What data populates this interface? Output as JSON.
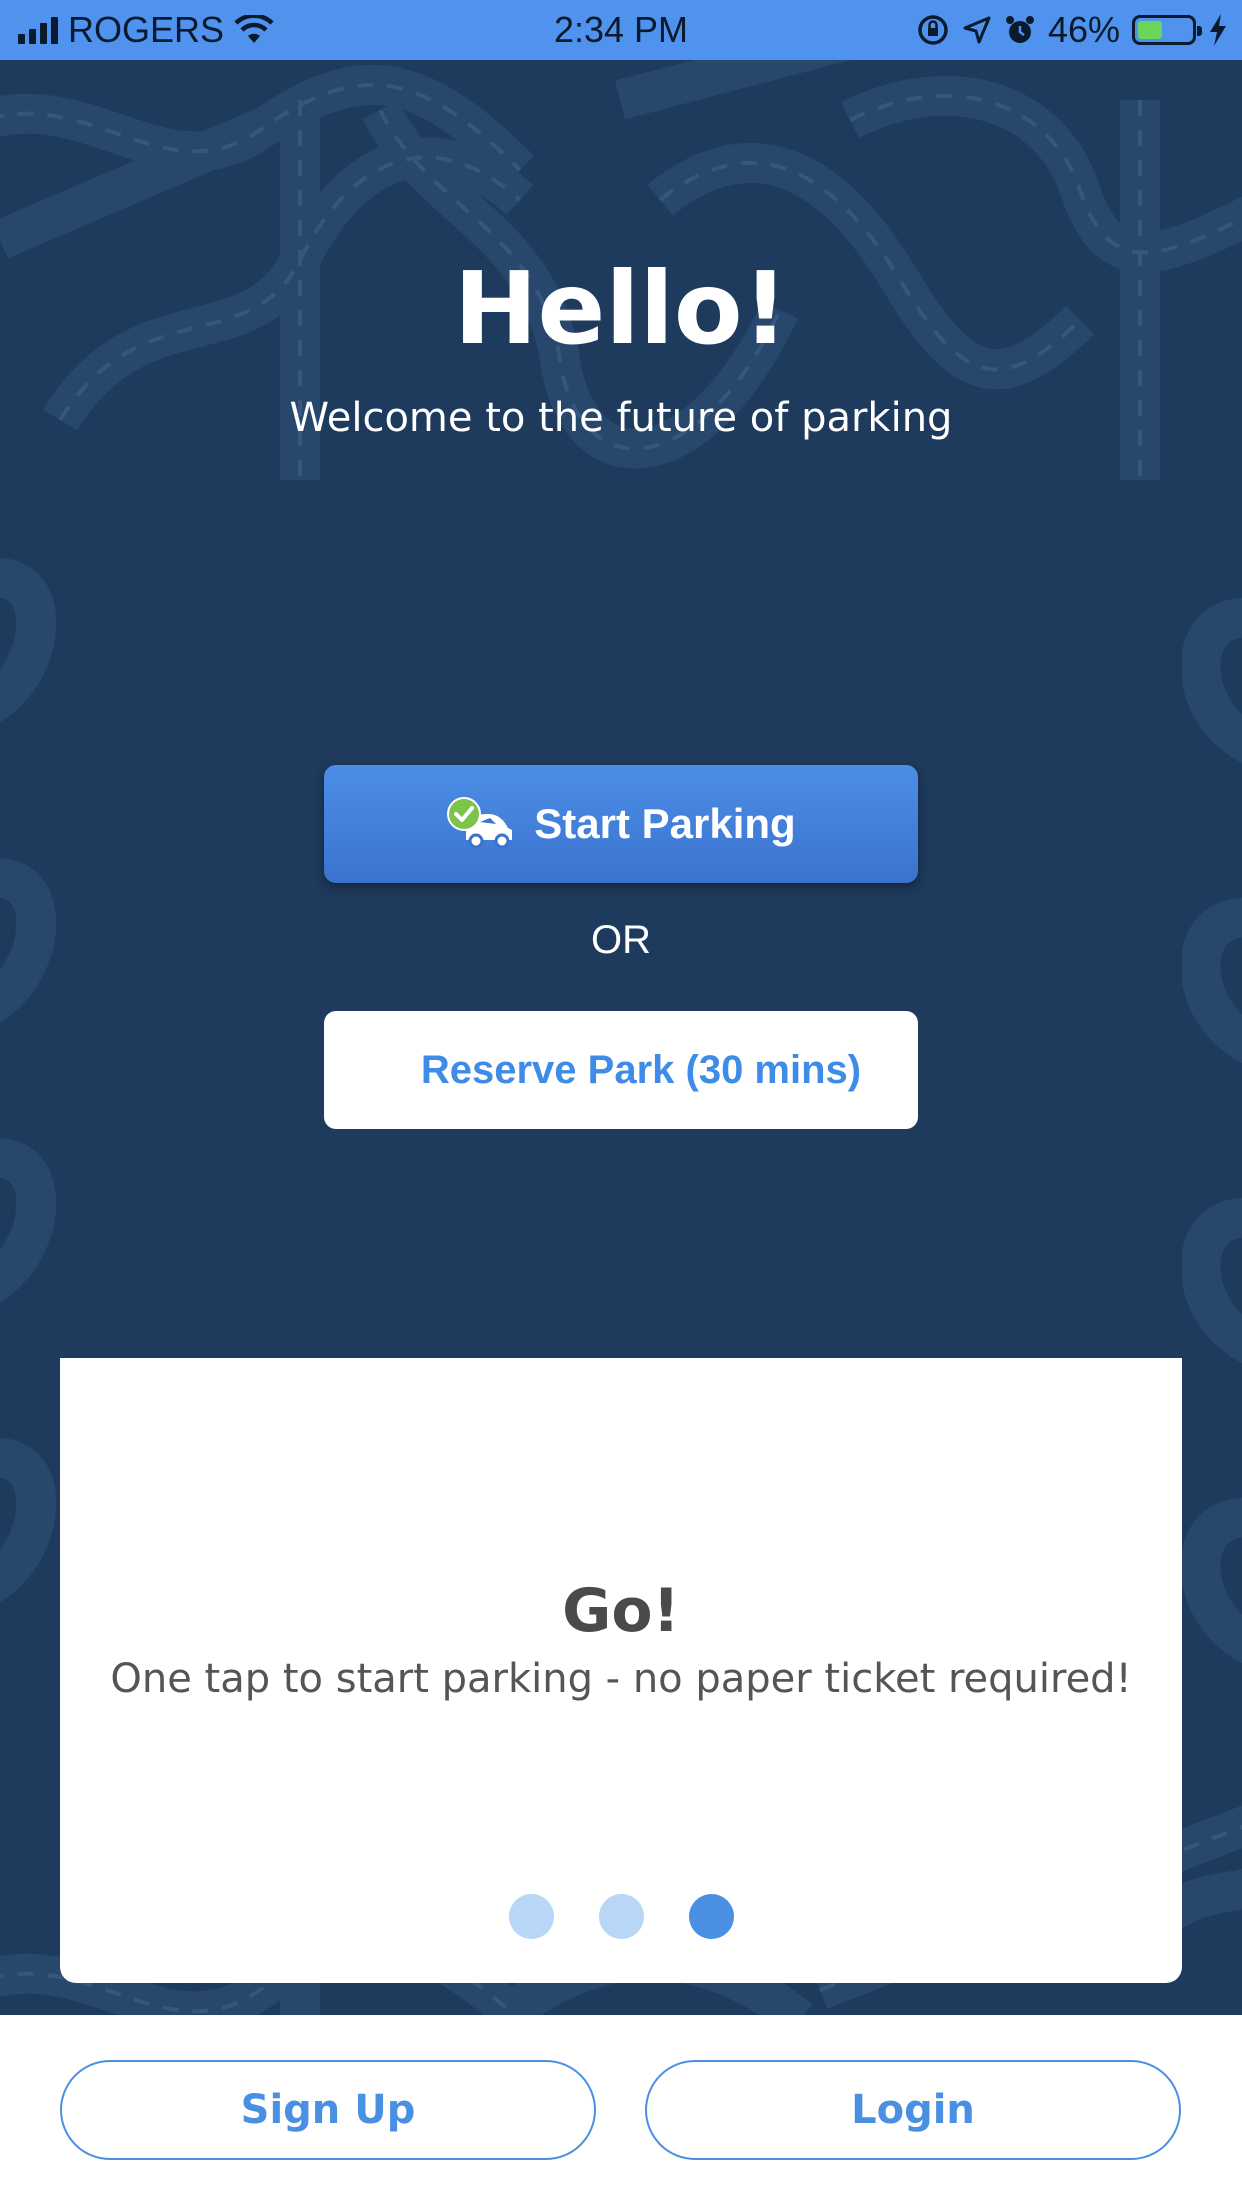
{
  "status_bar": {
    "carrier": "ROGERS",
    "time": "2:34 PM",
    "battery_percent": "46%",
    "battery_level": 0.46,
    "battery_color": "#6bd55a"
  },
  "header": {
    "title": "Hello!",
    "subtitle": "Welcome to the future of parking"
  },
  "actions": {
    "start_label": "Start Parking",
    "or_label": "OR",
    "reserve_label": "Reserve Park (30 mins)"
  },
  "onboarding_card": {
    "title": "Go!",
    "text": "One tap to start parking - no paper ticket required!",
    "page_count": 3,
    "active_page": 3
  },
  "footer": {
    "signup_label": "Sign Up",
    "login_label": "Login"
  },
  "colors": {
    "background": "#1e3a5c",
    "accent": "#4a90e2",
    "status_bar": "#4f93ee"
  }
}
